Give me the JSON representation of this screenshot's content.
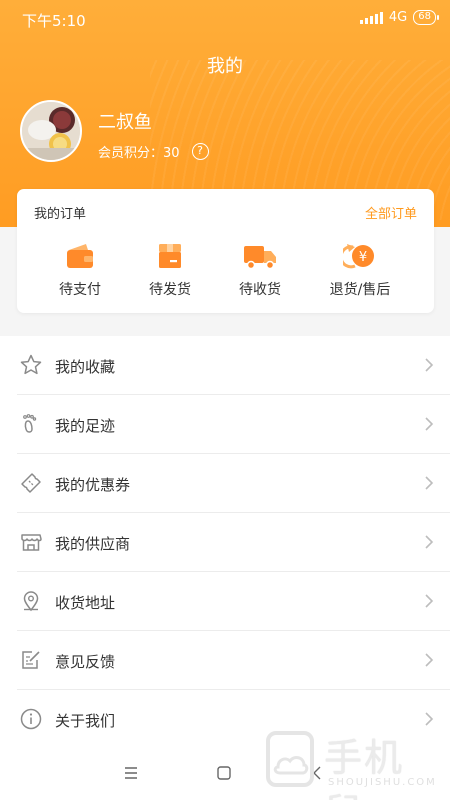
{
  "status_bar": {
    "time": "下午5:10",
    "network": "4G",
    "battery": "68"
  },
  "header": {
    "title": "我的"
  },
  "profile": {
    "name": "二叔鱼",
    "points_label": "会员积分：30",
    "help": "?"
  },
  "orders": {
    "title": "我的订单",
    "all_link": "全部订单",
    "items": [
      {
        "label": "待支付",
        "icon": "wallet-icon"
      },
      {
        "label": "待发货",
        "icon": "box-icon"
      },
      {
        "label": "待收货",
        "icon": "truck-icon"
      },
      {
        "label": "退货/售后",
        "icon": "refund-icon"
      }
    ]
  },
  "menu": {
    "items": [
      {
        "label": "我的收藏",
        "icon": "star-icon"
      },
      {
        "label": "我的足迹",
        "icon": "footprint-icon"
      },
      {
        "label": "我的优惠券",
        "icon": "coupon-icon"
      },
      {
        "label": "我的供应商",
        "icon": "store-icon"
      },
      {
        "label": "收货地址",
        "icon": "location-pin-icon"
      },
      {
        "label": "意见反馈",
        "icon": "feedback-icon"
      },
      {
        "label": "关于我们",
        "icon": "info-icon"
      }
    ]
  },
  "watermark": {
    "text": "手机鼠",
    "subtext": "SHOUJISHU.COM"
  },
  "colors": {
    "accent": "#ff9c22",
    "text": "#333333",
    "icon_gray": "#8a8a8a"
  }
}
